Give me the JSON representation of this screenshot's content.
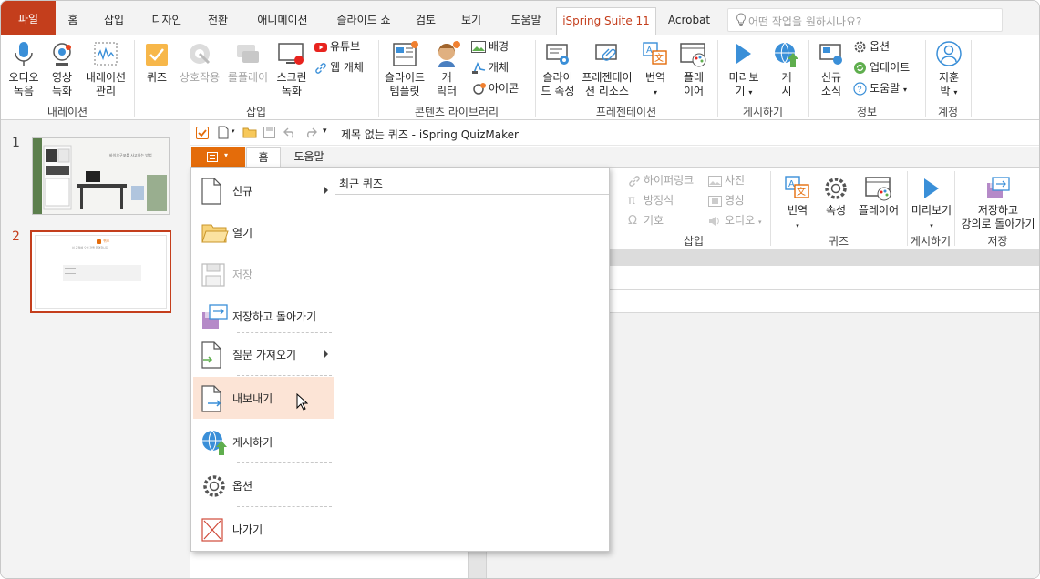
{
  "ppt": {
    "tabs": [
      "파일",
      "홈",
      "삽입",
      "디자인",
      "전환",
      "애니메이션",
      "슬라이드 쇼",
      "검토",
      "보기",
      "도움말",
      "iSpring Suite 11",
      "Acrobat"
    ],
    "search_placeholder": "어떤 작업을 원하시나요?",
    "ribbon": {
      "audio": [
        "오디오",
        "녹음"
      ],
      "video": [
        "영상",
        "녹화"
      ],
      "narration": [
        "내레이션",
        "관리"
      ],
      "quiz": "퀴즈",
      "interaction": "상호작용",
      "roleplay": "롤플레이",
      "screen": [
        "스크린",
        "녹화"
      ],
      "youtube": "유튜브",
      "web_object": "웹 개체",
      "slide_templates": [
        "슬라이드",
        "템플릿"
      ],
      "characters": [
        "캐",
        "릭터"
      ],
      "backgrounds": "배경",
      "objects": "개체",
      "icons": "아이콘",
      "slide_props": [
        "슬라이",
        "드 속성"
      ],
      "presentation_resources": [
        "프레젠테이",
        "션 리소스"
      ],
      "translate": "번역",
      "player": [
        "플레",
        "이어"
      ],
      "preview": [
        "미리보",
        "기"
      ],
      "publish": [
        "게",
        "시"
      ],
      "news": [
        "신규",
        "소식"
      ],
      "options": "옵션",
      "update": "업데이트",
      "help": "도움말",
      "account": [
        "지훈",
        "박"
      ],
      "groups": [
        "내레이션",
        "삽입",
        "콘텐츠 라이브러리",
        "프레젠테이션",
        "게시하기",
        "정보",
        "계정"
      ]
    }
  },
  "slides": {
    "numbers": [
      "1",
      "2"
    ],
    "slide1_title": "바이오구포를 사고하는 방법",
    "slide2_title": "퀴즈",
    "slide2_subtitle": "이 과정에 오신 것을 환영합니다"
  },
  "quizmaker": {
    "title": "제목 없는 퀴즈 - iSpring QuizMaker",
    "tabs": [
      "홈",
      "도움말"
    ],
    "ribbon": {
      "hyperlink": "하이퍼링크",
      "equation": "방정식",
      "symbol": "기호",
      "picture": "사진",
      "video": "영상",
      "audio": "오디오",
      "translate": "번역",
      "properties": "속성",
      "player": "플레이어",
      "preview": "미리보기",
      "save_return": [
        "저장하고",
        "강의로 돌아가기"
      ],
      "groups": [
        "삽입",
        "퀴즈",
        "게시하기",
        "저장"
      ]
    },
    "file_menu": {
      "items": [
        {
          "label": "신규",
          "has_submenu": true
        },
        {
          "label": "열기"
        },
        {
          "label": "저장",
          "disabled": true
        },
        {
          "label": "저장하고 돌아가기"
        },
        {
          "label": "질문 가져오기",
          "has_submenu": true
        },
        {
          "label": "내보내기",
          "highlighted": true
        },
        {
          "label": "게시하기"
        },
        {
          "label": "옵션"
        },
        {
          "label": "나가기"
        }
      ],
      "recent_header": "최근 퀴즈"
    }
  },
  "colors": {
    "accent": "#c43e1c",
    "quiz_orange": "#e46c0a",
    "hover": "#fce4d6"
  }
}
